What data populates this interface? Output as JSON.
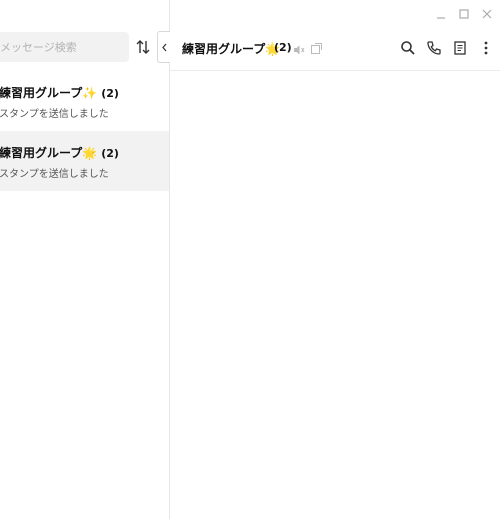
{
  "search": {
    "placeholder": "メッセージ検索"
  },
  "chats": [
    {
      "name": "練習用グループ",
      "emoji": "✨",
      "count": "(2)",
      "preview": "スタンプを送信しました"
    },
    {
      "name": "練習用グループ",
      "emoji": "🌟",
      "count": "(2)",
      "preview": "スタンプを送信しました"
    }
  ],
  "header": {
    "name": "練習用グループ",
    "emoji": "🌟",
    "count": "(2)"
  },
  "icons": {
    "sort": "sort-arrows-icon",
    "collapse": "chevron-left-icon",
    "mute": "speaker-muted-icon",
    "external": "open-external-icon",
    "search": "search-icon",
    "call": "phone-icon",
    "notes": "note-icon",
    "more": "more-vertical-icon",
    "minimize": "minimize-icon",
    "maximize": "maximize-icon",
    "close": "close-icon"
  },
  "colors": {
    "selected_bg": "#f2f2f2",
    "icon": "#333333",
    "faint_icon": "#bbbbbb"
  }
}
